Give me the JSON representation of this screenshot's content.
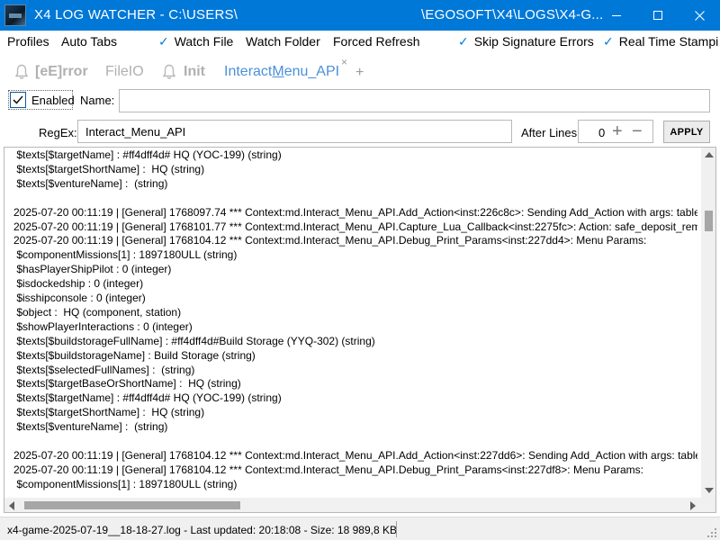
{
  "window": {
    "title_left": "X4 LOG WATCHER - C:\\USERS\\",
    "title_right": "\\EGOSOFT\\X4\\LOGS\\X4-G..."
  },
  "menu": {
    "profiles": "Profiles",
    "auto_tabs": "Auto Tabs",
    "watch_file": "Watch File",
    "watch_folder": "Watch Folder",
    "forced_refresh": "Forced Refresh",
    "skip_signature_errors": "Skip Signature Errors",
    "real_time_stamping": "Real Time Stampi",
    "check_glyph": "✓"
  },
  "tabs": [
    {
      "label": "[eE]rror"
    },
    {
      "label": "FileIO"
    },
    {
      "label": "Init"
    },
    {
      "label_pre": "Interact",
      "label_u": "M",
      "label_post": "enu_API"
    }
  ],
  "tab_controls": {
    "close": "×",
    "add": "+"
  },
  "filter": {
    "enabled_label": "Enabled",
    "name_label": "Name:",
    "name_value": "",
    "regex_label": "RegEx:",
    "regex_value": "Interact_Menu_API",
    "after_lines_label": "After Lines:",
    "after_lines_value": "0",
    "plus": "+",
    "minus": "−",
    "apply_label": "APPLY"
  },
  "log_lines": [
    " $texts[$targetName] : #ff4dff4d# HQ (YOC-199) (string)",
    " $texts[$targetShortName] :  HQ (string)",
    " $texts[$ventureName] :  (string)",
    "",
    "2025-07-20 00:11:19 | [General] 1768097.74 *** Context:md.Interact_Menu_API.Add_Action<inst:226c8c>: Sending Add_Action with args: table[$",
    "2025-07-20 00:11:19 | [General] 1768101.77 *** Context:md.Interact_Menu_API.Capture_Lua_Callback<inst:2275fc>: Action: safe_deposit_remote",
    "2025-07-20 00:11:19 | [General] 1768104.12 *** Context:md.Interact_Menu_API.Debug_Print_Params<inst:227dd4>: Menu Params:",
    " $componentMissions[1] : 1897180ULL (string)",
    " $hasPlayerShipPilot : 0 (integer)",
    " $isdockedship : 0 (integer)",
    " $isshipconsole : 0 (integer)",
    " $object :  HQ (component, station)",
    " $showPlayerInteractions : 0 (integer)",
    " $texts[$buildstorageFullName] : #ff4dff4d#Build Storage (YYQ-302) (string)",
    " $texts[$buildstorageName] : Build Storage (string)",
    " $texts[$selectedFullNames] :  (string)",
    " $texts[$targetBaseOrShortName] :  HQ (string)",
    " $texts[$targetName] : #ff4dff4d# HQ (YOC-199) (string)",
    " $texts[$targetShortName] :  HQ (string)",
    " $texts[$ventureName] :  (string)",
    "",
    "2025-07-20 00:11:19 | [General] 1768104.12 *** Context:md.Interact_Menu_API.Add_Action<inst:227dd6>: Sending Add_Action with args: table[$",
    "2025-07-20 00:11:19 | [General] 1768104.12 *** Context:md.Interact_Menu_API.Debug_Print_Params<inst:227df8>: Menu Params:",
    " $componentMissions[1] : 1897180ULL (string)"
  ],
  "status": {
    "text": "x4-game-2025-07-19__18-18-27.log - Last updated: 20:18:08 - Size: 18 989,8 KB"
  },
  "colors": {
    "titlebar": "#0078d7",
    "accent": "#0078d7",
    "active_tab": "#4a90d9",
    "inactive_tab": "#b0b0b0"
  },
  "icons": [
    "app-icon",
    "minimize-icon",
    "maximize-icon",
    "close-icon",
    "check-icon",
    "bell-icon",
    "tab-close-icon",
    "add-tab-icon",
    "resize-grip-icon"
  ]
}
